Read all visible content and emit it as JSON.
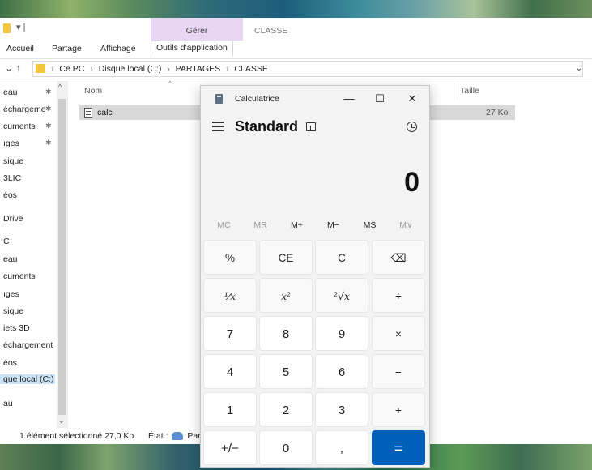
{
  "explorer": {
    "context_tab_group": "Gérer",
    "window_title": "CLASSE",
    "ribbon_tabs": [
      "Accueil",
      "Partage",
      "Affichage",
      "Outils d'application"
    ],
    "breadcrumbs": [
      "Ce PC",
      "Disque local (C:)",
      "PARTAGES",
      "CLASSE"
    ],
    "nav_items": [
      {
        "label": "eau",
        "pinned": true
      },
      {
        "label": "échargeme",
        "pinned": true
      },
      {
        "label": "cuments",
        "pinned": true
      },
      {
        "label": "ıges",
        "pinned": true
      },
      {
        "label": "sique",
        "pinned": false
      },
      {
        "label": "3LIC",
        "pinned": false
      },
      {
        "label": "éos",
        "pinned": false
      },
      {
        "label": "Drive",
        "pinned": false
      },
      {
        "label": "C",
        "pinned": false
      },
      {
        "label": "eau",
        "pinned": false
      },
      {
        "label": "cuments",
        "pinned": false
      },
      {
        "label": "ıges",
        "pinned": false
      },
      {
        "label": "sique",
        "pinned": false
      },
      {
        "label": "iets 3D",
        "pinned": false
      },
      {
        "label": "échargements",
        "pinned": false
      },
      {
        "label": "éos",
        "pinned": false
      },
      {
        "label": "que local (C:)",
        "pinned": false,
        "selected": true
      },
      {
        "label": "au",
        "pinned": false
      }
    ],
    "columns": {
      "name": "Nom",
      "size": "Taille"
    },
    "files": [
      {
        "name": "calc",
        "size": "27 Ko"
      }
    ],
    "status": {
      "selection": "1 élément sélectionné 27,0 Ko",
      "state": "État :",
      "state_value": "Parta"
    }
  },
  "calculator": {
    "title": "Calculatrice",
    "minimize": "—",
    "maximize": "☐",
    "close": "✕",
    "mode": "Standard",
    "display": "0",
    "memory_buttons": [
      {
        "label": "MC",
        "enabled": false
      },
      {
        "label": "MR",
        "enabled": false
      },
      {
        "label": "M+",
        "enabled": true
      },
      {
        "label": "M−",
        "enabled": true
      },
      {
        "label": "MS",
        "enabled": true
      },
      {
        "label": "M∨",
        "enabled": false
      }
    ],
    "keys": [
      [
        "%",
        "CE",
        "C",
        "⌫"
      ],
      [
        "¹⁄x",
        "x²",
        "²√x",
        "÷"
      ],
      [
        "7",
        "8",
        "9",
        "×"
      ],
      [
        "4",
        "5",
        "6",
        "−"
      ],
      [
        "1",
        "2",
        "3",
        "+"
      ],
      [
        "+/−",
        "0",
        ",",
        "="
      ]
    ]
  }
}
